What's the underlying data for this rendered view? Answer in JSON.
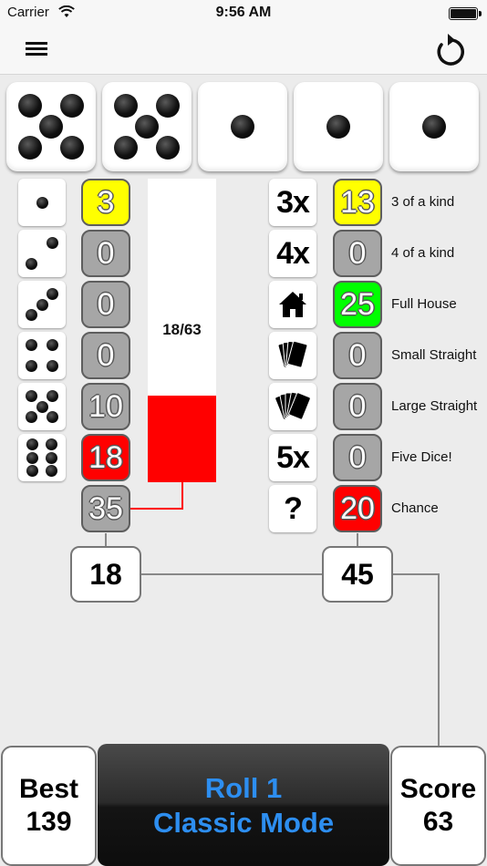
{
  "status_bar": {
    "carrier": "Carrier",
    "time": "9:56 AM"
  },
  "nav": {
    "menu_icon": "hamburger-menu-icon",
    "reset_icon": "undo-arrow-icon"
  },
  "dice": [
    5,
    5,
    1,
    1,
    1
  ],
  "upper_section": {
    "faces": [
      1,
      2,
      3,
      4,
      5,
      6
    ],
    "scores": [
      "3",
      "0",
      "0",
      "0",
      "10",
      "18"
    ],
    "score_colors": [
      "yellow",
      "gray",
      "gray",
      "gray",
      "gray",
      "red"
    ],
    "bonus": "35",
    "progress_text": "18/63",
    "progress_fraction": 0.2857,
    "total": "18"
  },
  "lower_section": {
    "categories": [
      {
        "icon": "3x",
        "label": "3 of a kind",
        "score": "13",
        "color": "yellow"
      },
      {
        "icon": "4x",
        "label": "4 of a kind",
        "score": "0",
        "color": "gray"
      },
      {
        "icon": "house-icon",
        "label": "Full House",
        "score": "25",
        "color": "green"
      },
      {
        "icon": "four-cards-icon",
        "label": "Small Straight",
        "score": "0",
        "color": "gray"
      },
      {
        "icon": "five-cards-icon",
        "label": "Large Straight",
        "score": "0",
        "color": "gray"
      },
      {
        "icon": "5x",
        "label": "Five Dice!",
        "score": "0",
        "color": "gray"
      },
      {
        "icon": "?",
        "label": "Chance",
        "score": "20",
        "color": "red"
      }
    ],
    "total": "45"
  },
  "bottom": {
    "best_label": "Best",
    "best_value": "139",
    "roll_label": "Roll 1",
    "mode_label": "Classic Mode",
    "score_label": "Score",
    "score_value": "63"
  },
  "colors": {
    "yellow": "#ffff00",
    "gray": "#a6a6a6",
    "red": "#ff0000",
    "green": "#00ff00",
    "roll_text": "#2d8ef0"
  }
}
